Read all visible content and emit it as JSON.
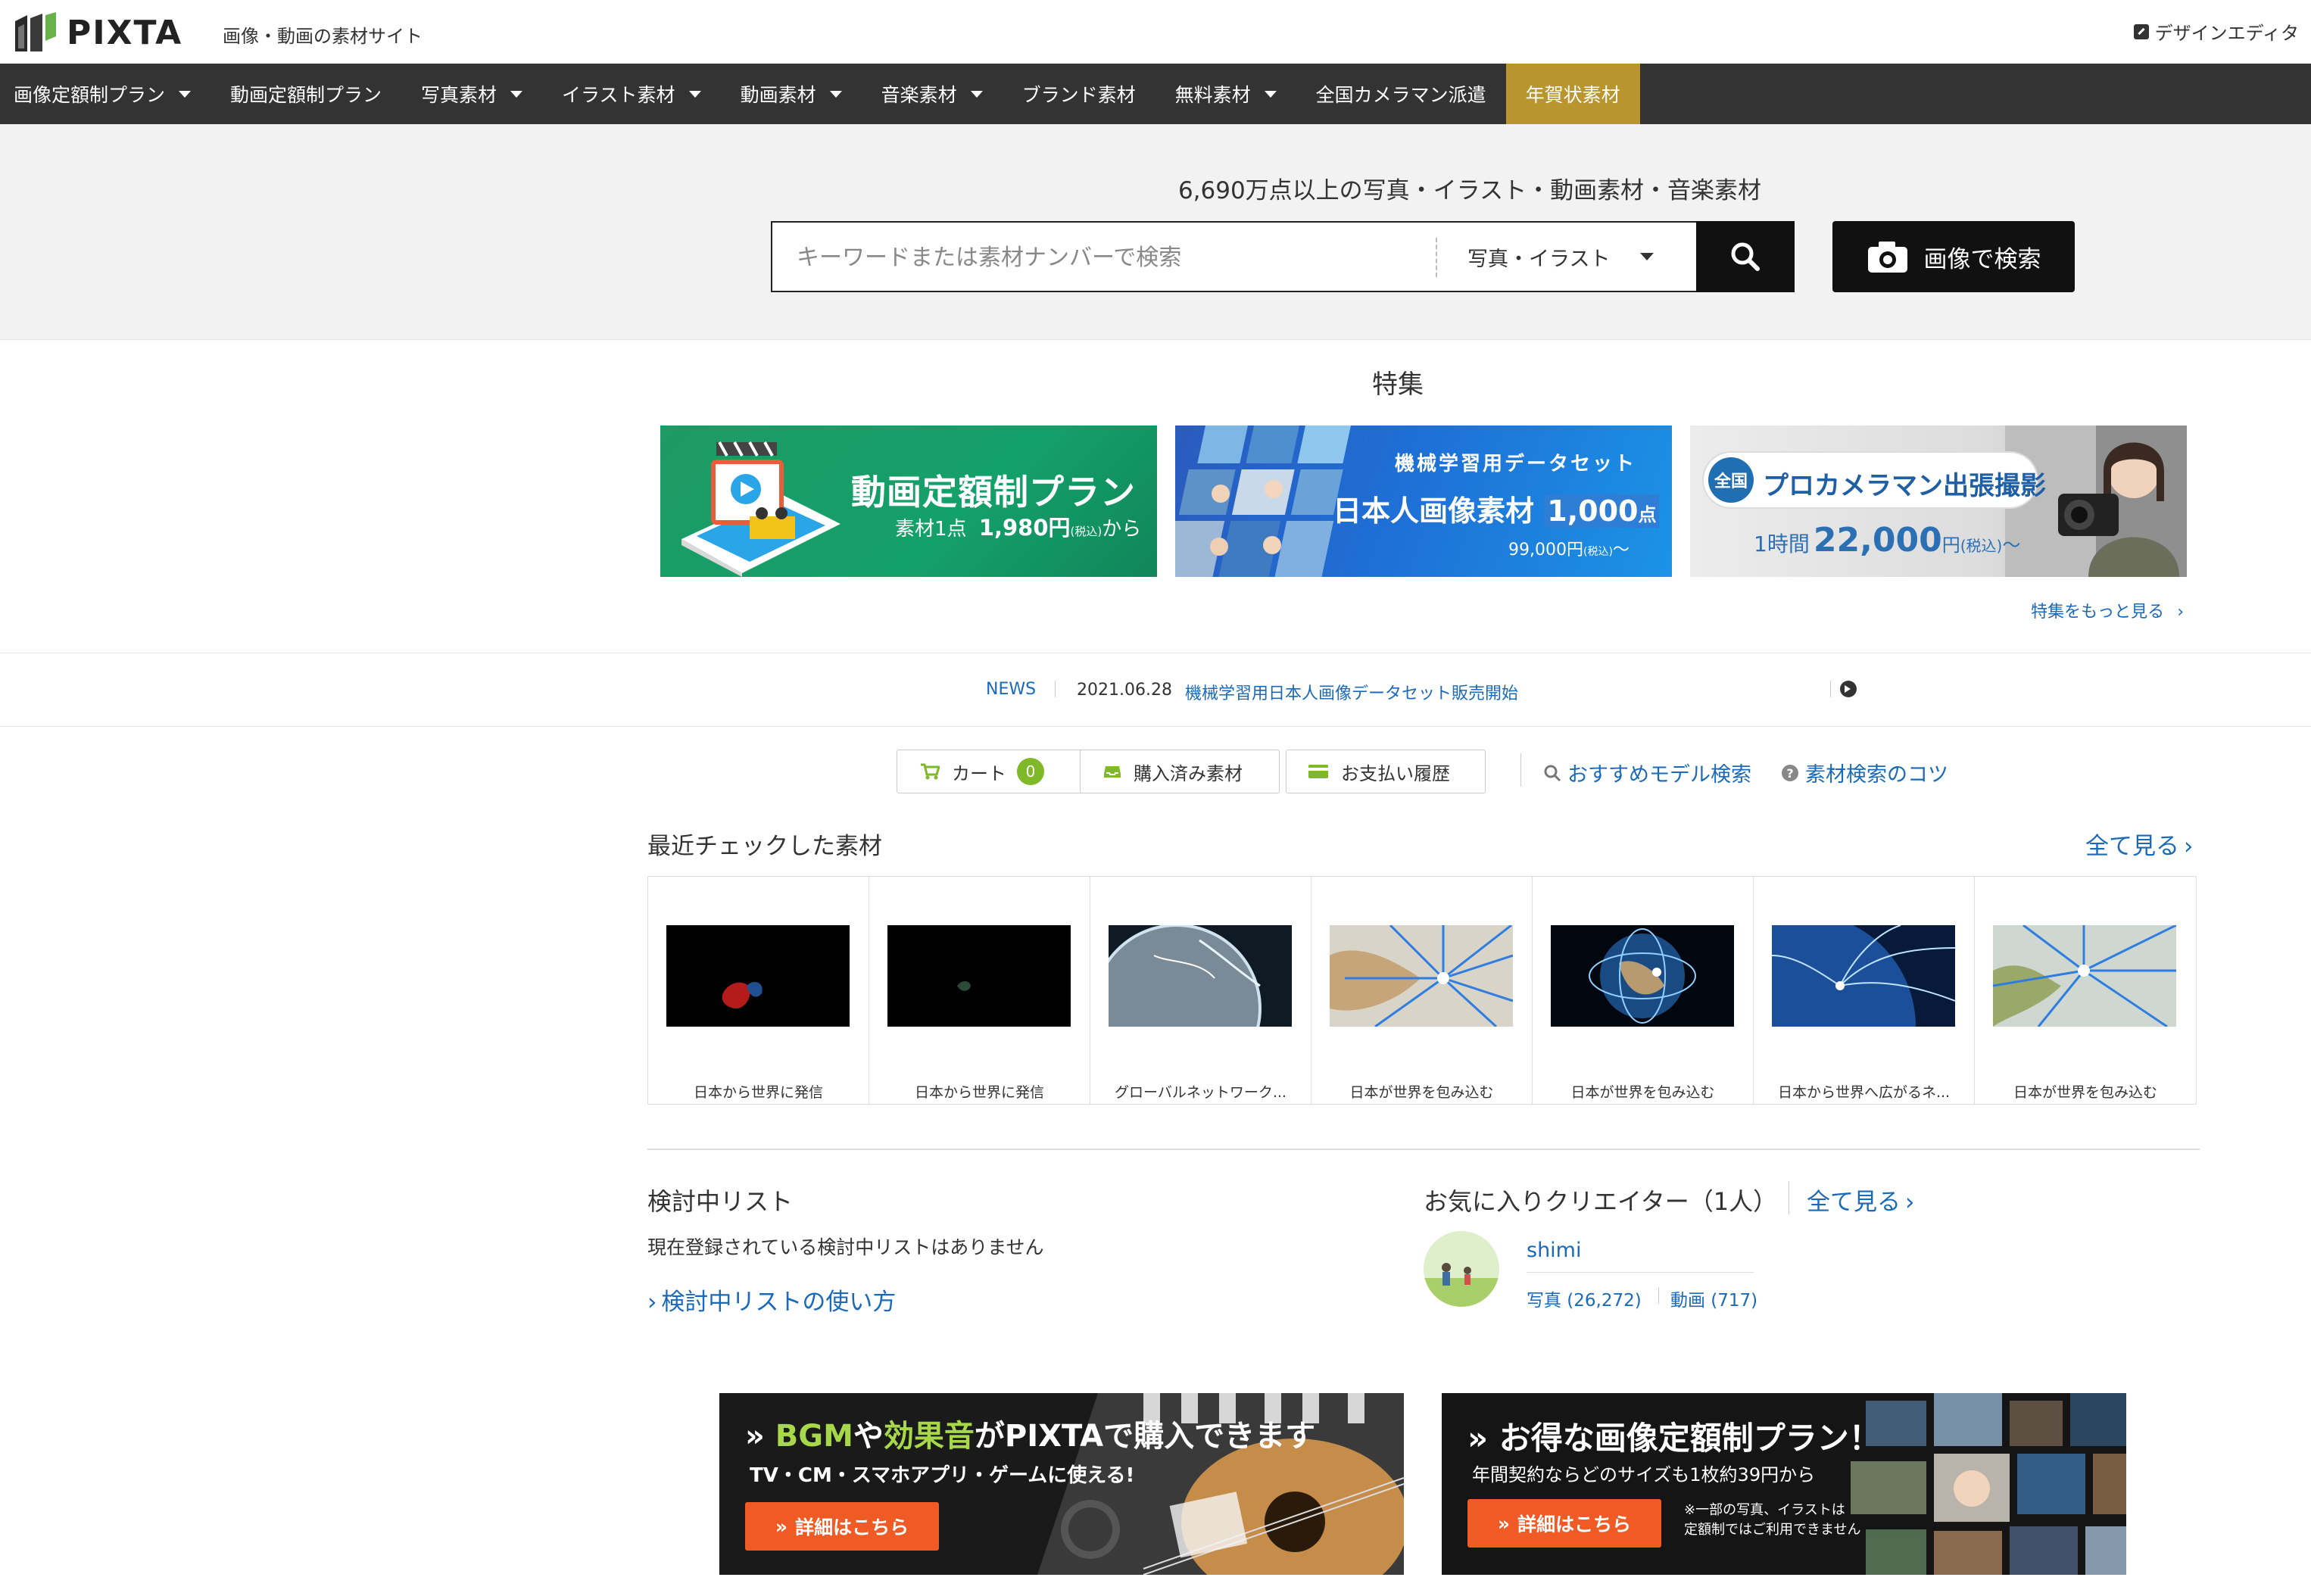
{
  "header": {
    "logo_text": "PIXTA",
    "tagline": "画像・動画の素材サイト",
    "design_editor": "デザインエディタ"
  },
  "nav": {
    "items": [
      {
        "label": "画像定額制プラン",
        "dropdown": true
      },
      {
        "label": "動画定額制プラン",
        "dropdown": false
      },
      {
        "label": "写真素材",
        "dropdown": true
      },
      {
        "label": "イラスト素材",
        "dropdown": true
      },
      {
        "label": "動画素材",
        "dropdown": true
      },
      {
        "label": "音楽素材",
        "dropdown": true
      },
      {
        "label": "ブランド素材",
        "dropdown": false
      },
      {
        "label": "無料素材",
        "dropdown": true
      },
      {
        "label": "全国カメラマン派遣",
        "dropdown": false
      },
      {
        "label": "年賀状素材",
        "dropdown": false
      }
    ],
    "highlight_color": "#b8952e"
  },
  "search": {
    "caption": "6,690万点以上の写真・イラスト・動画素材・音楽素材",
    "placeholder": "キーワードまたは素材ナンバーで検索",
    "type_selected": "写真・イラスト",
    "image_search_label": "画像で検索"
  },
  "features": {
    "title": "特集",
    "banners": [
      {
        "title": "動画定額制プラン",
        "sub_prefix": "素材1点",
        "price": "1,980円",
        "tax": "(税込)",
        "suffix": "から"
      },
      {
        "line1": "機械学習用データセット",
        "line2": "日本人画像素材",
        "count": "1,000",
        "count_unit": "点",
        "price": "99,000円",
        "tax": "(税込)",
        "suffix": "〜"
      },
      {
        "badge": "全国",
        "title": "プロカメラマン出張撮影",
        "prefix": "1時間",
        "price": "22,000",
        "unit": "円",
        "tax": "(税込)",
        "suffix": "〜"
      }
    ],
    "more_label": "特集をもっと見る"
  },
  "news": {
    "label": "NEWS",
    "date": "2021.06.28",
    "text": "機械学習用日本人画像データセット販売開始"
  },
  "user_actions": {
    "cart_label": "カート",
    "cart_count": "0",
    "purchased_label": "購入済み素材",
    "payment_label": "お支払い履歴",
    "model_search": "おすすめモデル検索",
    "search_tips": "素材検索のコツ"
  },
  "recent": {
    "title": "最近チェックした素材",
    "see_all": "全て見る",
    "items": [
      {
        "caption": "日本から世界に発信"
      },
      {
        "caption": "日本から世界に発信"
      },
      {
        "caption": "グローバルネットワーク..."
      },
      {
        "caption": "日本が世界を包み込む"
      },
      {
        "caption": "日本が世界を包み込む"
      },
      {
        "caption": "日本から世界へ広がるネ..."
      },
      {
        "caption": "日本が世界を包み込む"
      }
    ]
  },
  "consider_list": {
    "title": "検討中リスト",
    "empty_text": "現在登録されている検討中リストはありません",
    "howto_link": "検討中リストの使い方"
  },
  "favorites": {
    "title": "お気に入りクリエイター（1人）",
    "see_all": "全て見る",
    "creator": {
      "name": "shimi",
      "photos": "写真 (26,272)",
      "videos": "動画 (717)"
    }
  },
  "promos": [
    {
      "headline_a": "BGM",
      "headline_b": "や",
      "headline_c": "効果音",
      "headline_d": "がPIXTAで購入できます",
      "sub": "TV・CM・スマホアプリ・ゲームに使える!",
      "cta": "詳細はこちら"
    },
    {
      "headline": "お得な画像定額制プラン！",
      "sub": "年間契約ならどのサイズも1枚約39円から",
      "cta": "詳細はこちら",
      "note1": "※一部の写真、イラストは",
      "note2": "定額制ではご利用できません"
    }
  ],
  "colors": {
    "link": "#1a6ab9",
    "nav_bg": "#333333",
    "cta": "#f05a24",
    "badge_green": "#7fb828"
  }
}
